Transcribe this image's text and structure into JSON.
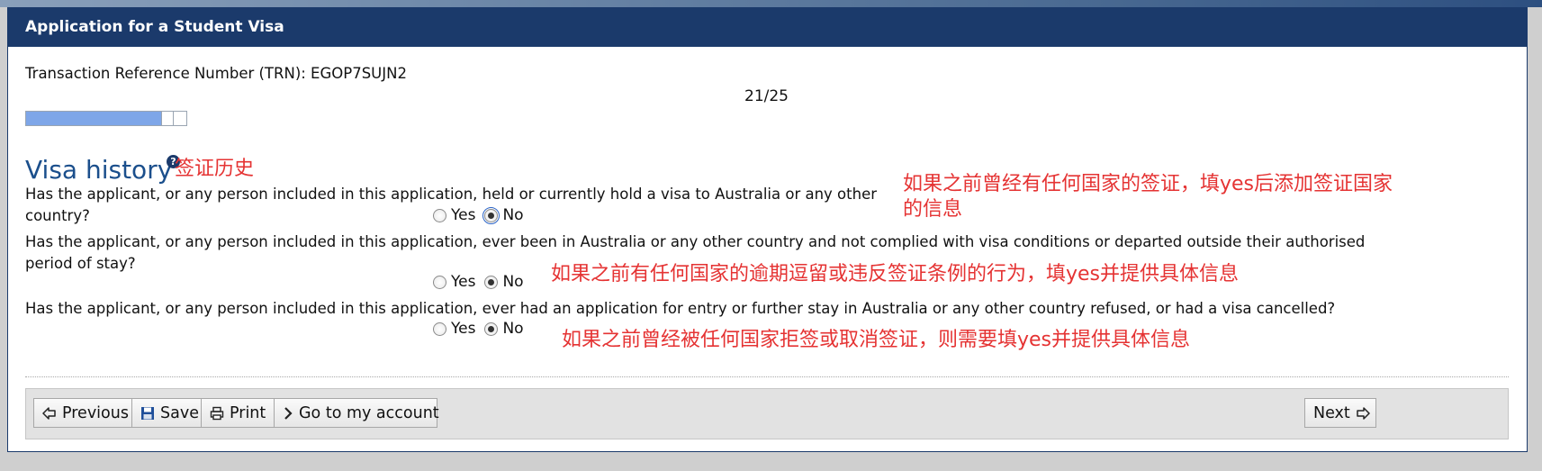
{
  "window": {
    "title": "Application for a Student Visa"
  },
  "trn": {
    "text": "Transaction Reference Number (TRN): EGOP7SUJN2"
  },
  "progress": {
    "page_label": "21/25",
    "fraction": 0.84
  },
  "section": {
    "title": "Visa history",
    "annotation": "签证历史"
  },
  "questions": [
    {
      "text": "Has the applicant, or any person included in this application, held or currently hold a visa to Australia or any other country?",
      "yes_label": "Yes",
      "no_label": "No",
      "selected": "No",
      "annotation_line1": "如果之前曾经有任何国家的签证，填yes后添加签证国家",
      "annotation_line2": "的信息"
    },
    {
      "text": "Has the applicant, or any person included in this application, ever been in Australia or any other country and not complied with visa conditions or departed outside their authorised period of stay?",
      "yes_label": "Yes",
      "no_label": "No",
      "selected": "No",
      "annotation": "如果之前有任何国家的逾期逗留或违反签证条例的行为，填yes并提供具体信息"
    },
    {
      "text": "Has the applicant, or any person included in this application, ever had an application for entry or further stay in Australia or any other country refused, or had a visa cancelled?",
      "yes_label": "Yes",
      "no_label": "No",
      "selected": "No",
      "annotation": "如果之前曾经被任何国家拒签或取消签证，则需要填yes并提供具体信息"
    }
  ],
  "nav": {
    "previous": "Previous",
    "save": "Save",
    "print": "Print",
    "account": "Go to my account",
    "next": "Next"
  },
  "icons": {
    "help": "question-circle-icon",
    "previous": "arrow-left-icon",
    "save": "floppy-disk-icon",
    "print": "printer-icon",
    "account": "chevron-right-icon",
    "next": "arrow-right-icon"
  },
  "colors": {
    "header": "#1b3a6b",
    "title": "#1b4f8c",
    "annotation": "#e53333",
    "progress_fill": "#7ea6e8"
  }
}
